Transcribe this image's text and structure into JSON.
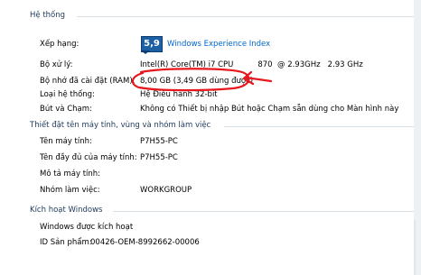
{
  "system_section": {
    "title": "Hệ thống",
    "rating_label": "Xếp hạng:",
    "rating_score": "5,9",
    "rating_link": "Windows Experience Index",
    "processor_label": "Bộ xử lý:",
    "processor_value": "Intel(R) Core(TM) i7 CPU          870  @ 2.93GHz   2.93 GHz",
    "ram_label": "Bộ nhớ đã cài đặt (RAM):",
    "ram_value": "8,00 GB (3,49 GB dùng được)",
    "type_label": "Loại hệ thống:",
    "type_value": "Hệ Điều hành 32-bit",
    "pen_label": "Bút và Chạm:",
    "pen_value": "Không có Thiết bị nhập Bút hoặc Chạm sẵn dùng cho Màn hình này"
  },
  "computer_section": {
    "title": "Thiết đặt tên máy tính, vùng và nhóm làm việc",
    "name_label": "Tên máy tính:",
    "name_value": "P7H55-PC",
    "full_name_label": "Tên đầy đủ của máy tính:",
    "full_name_value": "P7H55-PC",
    "description_label": "Mô tả máy tính:",
    "description_value": "",
    "workgroup_label": "Nhóm làm việc:",
    "workgroup_value": "WORKGROUP"
  },
  "activation_section": {
    "title": "Kích hoạt Windows",
    "status": "Windows được kích hoạt",
    "product_id_label": "ID Sản phẩm:",
    "product_id_value": "00426-OEM-8992662-00006"
  },
  "colors": {
    "section_title": "#1e395b",
    "link": "#0066cc",
    "annotation_red": "#e8171c",
    "badge_blue": "#1d5fa5"
  }
}
